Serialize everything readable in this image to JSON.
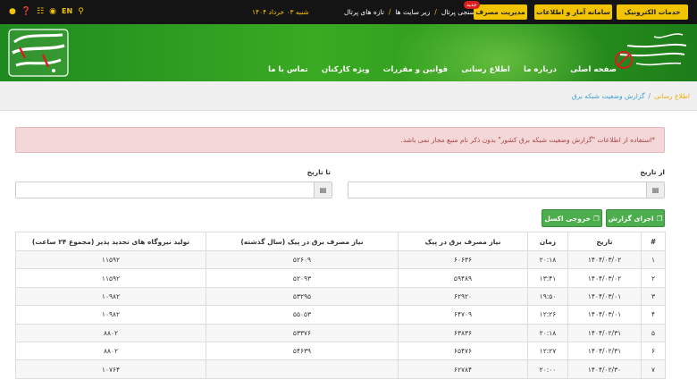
{
  "topbar": {
    "icons": [
      "search-icon",
      "en-link",
      "rss-icon",
      "sitemap-icon",
      "help-icon",
      "accessibility-icon"
    ],
    "lang": "EN",
    "date": "شنبه ۰۳ خرداد ۱۴۰۴",
    "links": [
      "نظرسنجی پرتال",
      "زیر سایت ها",
      "تازه های پرتال"
    ],
    "btn_consumption": "مدیریت مصرف",
    "badge_new": "جدید",
    "btn_stats": "سامانه آمار و اطلاعات",
    "btn_eservices": "خدمات الکترونیک"
  },
  "header": {
    "nav": [
      "صفحه اصلی",
      "درباره ما",
      "اطلاع رسانی",
      "قوانین و مقررات",
      "ویژه کارکنان",
      "تماس با ما"
    ]
  },
  "breadcrumb": {
    "parent": "اطلاع رسانی",
    "sep": "/",
    "current": "گزارش وضعیت شبکه برق"
  },
  "alert": {
    "text": "*استفاده از اطلاعات \"گزارش وضعیت شبکه برق کشور\" بدون ذکر نام منبع مجاز نمی باشد."
  },
  "form": {
    "from_label": "از تاریخ",
    "to_label": "تا تاریخ",
    "from_value": "",
    "to_value": "",
    "run_report": "اجرای گزارش",
    "excel_export": "خروجی اکسل"
  },
  "table": {
    "headers": [
      "#",
      "تاریخ",
      "زمان",
      "نیاز مصرف برق در پیک",
      "نیاز مصرف برق در پیک (سال گذشته)",
      "تولید نیروگاه های تجدید پذیر (مجموع ۲۴ ساعت)"
    ],
    "rows": [
      [
        "۱",
        "۱۴۰۴/۰۳/۰۲",
        "۲۰:۱۸",
        "۶۰۶۳۶",
        "۵۲۶۰۹",
        "۱۱۵۹۲"
      ],
      [
        "۲",
        "۱۴۰۴/۰۳/۰۲",
        "۱۳:۴۱",
        "۵۹۴۸۹",
        "۵۲۰۹۳",
        "۱۱۵۹۲"
      ],
      [
        "۳",
        "۱۴۰۴/۰۳/۰۱",
        "۱۹:۵۰",
        "۶۲۹۲۰",
        "۵۳۲۹۵",
        "۱۰۹۸۲"
      ],
      [
        "۴",
        "۱۴۰۴/۰۳/۰۱",
        "۱۲:۲۶",
        "۶۴۷۰۹",
        "۵۵۰۵۳",
        "۱۰۹۸۲"
      ],
      [
        "۵",
        "۱۴۰۴/۰۲/۳۱",
        "۲۰:۱۸",
        "۶۳۸۳۶",
        "۵۳۳۷۶",
        "۸۸۰۲"
      ],
      [
        "۶",
        "۱۴۰۴/۰۲/۳۱",
        "۱۲:۲۷",
        "۶۵۴۷۶",
        "۵۴۶۳۹",
        "۸۸۰۲"
      ],
      [
        "۷",
        "۱۴۰۴/۰۲/۳۰",
        "۲۰:۰۰",
        "۶۲۷۸۴",
        "",
        "۱۰۷۶۴"
      ]
    ]
  }
}
